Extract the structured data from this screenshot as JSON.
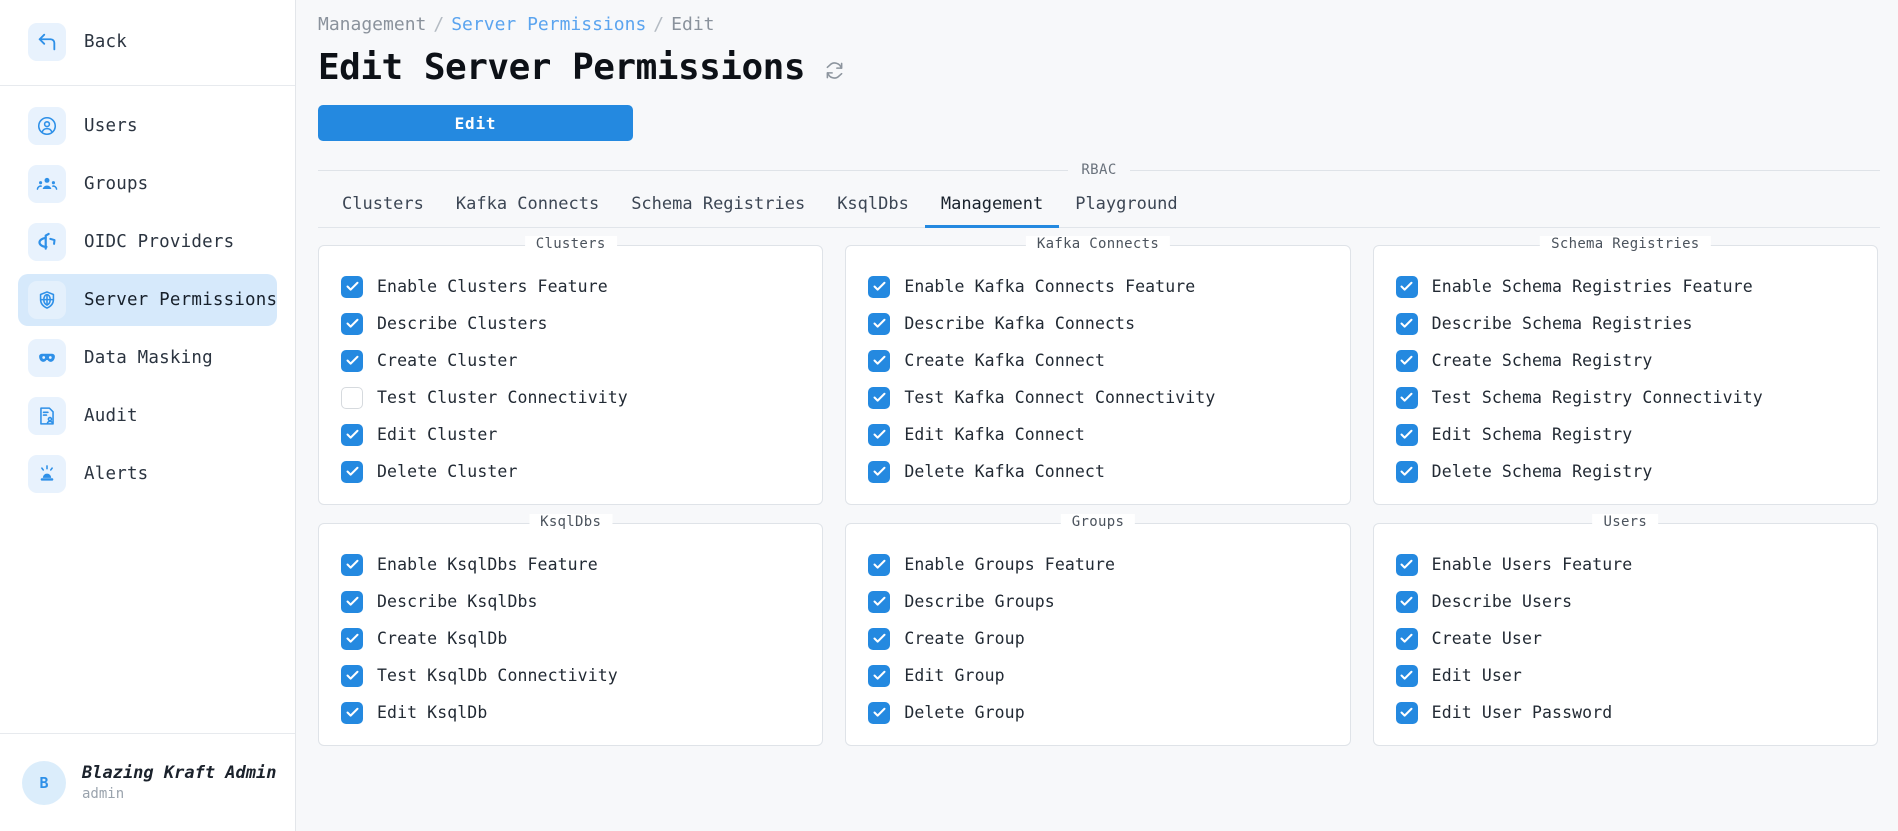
{
  "sidebar": {
    "back": {
      "label": "Back",
      "icon": "back-arrow-icon"
    },
    "items": [
      {
        "label": "Users",
        "icon": "user-circle-icon",
        "active": false
      },
      {
        "label": "Groups",
        "icon": "groups-icon",
        "active": false
      },
      {
        "label": "OIDC Providers",
        "icon": "oidc-icon",
        "active": false
      },
      {
        "label": "Server Permissions",
        "icon": "shield-globe-icon",
        "active": true
      },
      {
        "label": "Data Masking",
        "icon": "mask-icon",
        "active": false
      },
      {
        "label": "Audit",
        "icon": "audit-document-icon",
        "active": false
      },
      {
        "label": "Alerts",
        "icon": "alert-siren-icon",
        "active": false
      }
    ],
    "user": {
      "initial": "B",
      "name": "Blazing Kraft Admin",
      "role": "admin"
    }
  },
  "header": {
    "breadcrumb": [
      {
        "label": "Management",
        "type": "muted"
      },
      {
        "label": "/",
        "type": "sep"
      },
      {
        "label": "Server Permissions",
        "type": "link"
      },
      {
        "label": "/",
        "type": "sep"
      },
      {
        "label": "Edit",
        "type": "muted"
      }
    ],
    "title": "Edit Server Permissions",
    "refresh_icon": "refresh-icon",
    "edit_button": "Edit"
  },
  "rbac": {
    "legend": "RBAC",
    "tabs": [
      {
        "label": "Clusters",
        "active": false
      },
      {
        "label": "Kafka Connects",
        "active": false
      },
      {
        "label": "Schema Registries",
        "active": false
      },
      {
        "label": "KsqlDbs",
        "active": false
      },
      {
        "label": "Management",
        "active": true
      },
      {
        "label": "Playground",
        "active": false
      }
    ],
    "cards": [
      {
        "title": "Clusters",
        "permissions": [
          {
            "label": "Enable Clusters Feature",
            "checked": true
          },
          {
            "label": "Describe Clusters",
            "checked": true
          },
          {
            "label": "Create Cluster",
            "checked": true
          },
          {
            "label": "Test Cluster Connectivity",
            "checked": false
          },
          {
            "label": "Edit Cluster",
            "checked": true
          },
          {
            "label": "Delete Cluster",
            "checked": true
          }
        ]
      },
      {
        "title": "Kafka Connects",
        "permissions": [
          {
            "label": "Enable Kafka Connects Feature",
            "checked": true
          },
          {
            "label": "Describe Kafka Connects",
            "checked": true
          },
          {
            "label": "Create Kafka Connect",
            "checked": true
          },
          {
            "label": "Test Kafka Connect Connectivity",
            "checked": true
          },
          {
            "label": "Edit Kafka Connect",
            "checked": true
          },
          {
            "label": "Delete Kafka Connect",
            "checked": true
          }
        ]
      },
      {
        "title": "Schema Registries",
        "permissions": [
          {
            "label": "Enable Schema Registries Feature",
            "checked": true
          },
          {
            "label": "Describe Schema Registries",
            "checked": true
          },
          {
            "label": "Create Schema Registry",
            "checked": true
          },
          {
            "label": "Test Schema Registry Connectivity",
            "checked": true
          },
          {
            "label": "Edit Schema Registry",
            "checked": true
          },
          {
            "label": "Delete Schema Registry",
            "checked": true
          }
        ]
      },
      {
        "title": "KsqlDbs",
        "permissions": [
          {
            "label": "Enable KsqlDbs Feature",
            "checked": true
          },
          {
            "label": "Describe KsqlDbs",
            "checked": true
          },
          {
            "label": "Create KsqlDb",
            "checked": true
          },
          {
            "label": "Test KsqlDb Connectivity",
            "checked": true
          },
          {
            "label": "Edit KsqlDb",
            "checked": true
          }
        ]
      },
      {
        "title": "Groups",
        "permissions": [
          {
            "label": "Enable Groups Feature",
            "checked": true
          },
          {
            "label": "Describe Groups",
            "checked": true
          },
          {
            "label": "Create Group",
            "checked": true
          },
          {
            "label": "Edit Group",
            "checked": true
          },
          {
            "label": "Delete Group",
            "checked": true
          }
        ]
      },
      {
        "title": "Users",
        "permissions": [
          {
            "label": "Enable Users Feature",
            "checked": true
          },
          {
            "label": "Describe Users",
            "checked": true
          },
          {
            "label": "Create User",
            "checked": true
          },
          {
            "label": "Edit User",
            "checked": true
          },
          {
            "label": "Edit User Password",
            "checked": true
          }
        ]
      }
    ]
  },
  "colors": {
    "accent": "#2489e0",
    "accent_soft": "#e8f2fd",
    "active_nav": "#d6e9fb",
    "page_bg": "#f7f8fa",
    "panel_bg": "#ffffff",
    "border": "#dfe3e8",
    "text": "#1b222c",
    "muted": "#8a929c",
    "link": "#5ba4ef"
  }
}
